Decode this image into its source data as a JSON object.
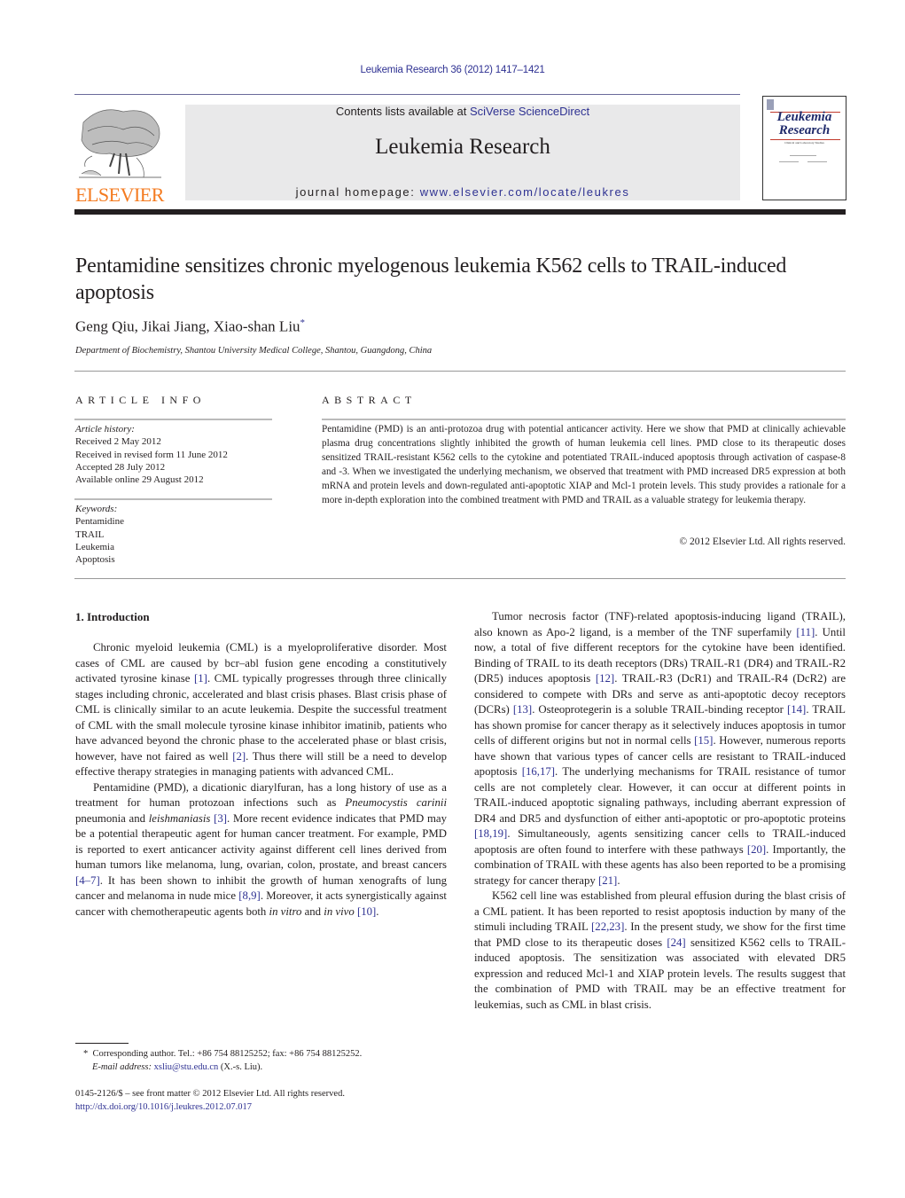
{
  "header": {
    "citation": "Leukemia Research 36 (2012) 1417–1421",
    "contents_prefix": "Contents lists available at ",
    "contents_link": "SciVerse ScienceDirect",
    "journal_name": "Leukemia Research",
    "homepage_prefix": "journal homepage: ",
    "homepage_link": "www.elsevier.com/locate/leukres",
    "publisher_logo_text": "ELSEVIER",
    "cover": {
      "title_line1": "Leukemia",
      "title_line2": "Research",
      "subtitle": "Clinical and Laboratory Studies"
    },
    "colors": {
      "link": "#2e3192",
      "elsevier_orange": "#f47b20",
      "masthead_bg": "#e9e9ea"
    }
  },
  "article": {
    "title": "Pentamidine sensitizes chronic myelogenous leukemia K562 cells to TRAIL-induced apoptosis",
    "authors": "Geng Qiu, Jikai Jiang, Xiao-shan Liu",
    "author_mark": "*",
    "affiliation": "Department of Biochemistry, Shantou University Medical College, Shantou, Guangdong, China"
  },
  "article_info": {
    "heading": "ARTICLE INFO",
    "history_label": "Article history:",
    "history": [
      "Received 2 May 2012",
      "Received in revised form 11 June 2012",
      "Accepted 28 July 2012",
      "Available online 29 August 2012"
    ],
    "keywords_label": "Keywords:",
    "keywords": [
      "Pentamidine",
      "TRAIL",
      "Leukemia",
      "Apoptosis"
    ]
  },
  "abstract": {
    "heading": "ABSTRACT",
    "text": "Pentamidine (PMD) is an anti-protozoa drug with potential anticancer activity. Here we show that PMD at clinically achievable plasma drug concentrations slightly inhibited the growth of human leukemia cell lines. PMD close to its therapeutic doses sensitized TRAIL-resistant K562 cells to the cytokine and potentiated TRAIL-induced apoptosis through activation of caspase-8 and -3. When we investigated the underlying mechanism, we observed that treatment with PMD increased DR5 expression at both mRNA and protein levels and down-regulated anti-apoptotic XIAP and Mcl-1 protein levels. This study provides a rationale for a more in-depth exploration into the combined treatment with PMD and TRAIL as a valuable strategy for leukemia therapy.",
    "copyright": "© 2012 Elsevier Ltd. All rights reserved."
  },
  "introduction": {
    "heading": "1.  Introduction",
    "left_paragraphs": [
      [
        {
          "t": "Chronic myeloid leukemia (CML) is a myeloproliferative disorder. Most cases of CML are caused by bcr–abl fusion gene encoding a constitutively activated tyrosine kinase "
        },
        {
          "t": "[1]",
          "ref": true
        },
        {
          "t": ". CML typically progresses through three clinically stages including chronic, accelerated and blast crisis phases. Blast crisis phase of CML is clinically similar to an acute leukemia. Despite the successful treatment of CML with the small molecule tyrosine kinase inhibitor imatinib, patients who have advanced beyond the chronic phase to the accelerated phase or blast crisis, however, have not faired as well "
        },
        {
          "t": "[2]",
          "ref": true
        },
        {
          "t": ". Thus there will still be a need to develop effective therapy strategies in managing patients with advanced CML."
        }
      ],
      [
        {
          "t": "Pentamidine (PMD), a dicationic diarylfuran, has a long history of use as a treatment for human protozoan infections such as "
        },
        {
          "t": "Pneumocystis carinii",
          "it": true
        },
        {
          "t": " pneumonia and "
        },
        {
          "t": "leishmaniasis",
          "it": true
        },
        {
          "t": " "
        },
        {
          "t": "[3]",
          "ref": true
        },
        {
          "t": ". More recent evidence indicates that PMD may be a potential therapeutic agent for human cancer treatment. For example, PMD is reported to exert anticancer activity against different cell lines derived from human tumors like melanoma, lung, ovarian, colon, prostate, and breast cancers "
        },
        {
          "t": "[4–7]",
          "ref": true
        },
        {
          "t": ". It has been shown to inhibit the growth of human xenografts of lung cancer and melanoma in nude mice "
        },
        {
          "t": "[8,9]",
          "ref": true
        },
        {
          "t": ". Moreover, it acts synergistically against cancer with chemotherapeutic agents both "
        },
        {
          "t": "in vitro",
          "it": true
        },
        {
          "t": " and "
        },
        {
          "t": "in vivo",
          "it": true
        },
        {
          "t": " "
        },
        {
          "t": "[10]",
          "ref": true
        },
        {
          "t": "."
        }
      ]
    ],
    "right_paragraphs": [
      [
        {
          "t": "Tumor necrosis factor (TNF)-related apoptosis-inducing ligand (TRAIL), also known as Apo-2 ligand, is a member of the TNF superfamily "
        },
        {
          "t": "[11]",
          "ref": true
        },
        {
          "t": ". Until now, a total of five different receptors for the cytokine have been identified. Binding of TRAIL to its death receptors (DRs) TRAIL-R1 (DR4) and TRAIL-R2 (DR5) induces apoptosis "
        },
        {
          "t": "[12]",
          "ref": true
        },
        {
          "t": ". TRAIL-R3 (DcR1) and TRAIL-R4 (DcR2) are considered to compete with DRs and serve as anti-apoptotic decoy receptors (DCRs) "
        },
        {
          "t": "[13]",
          "ref": true
        },
        {
          "t": ". Osteoprotegerin is a soluble TRAIL-binding receptor "
        },
        {
          "t": "[14]",
          "ref": true
        },
        {
          "t": ". TRAIL has shown promise for cancer therapy as it selectively induces apoptosis in tumor cells of different origins but not in normal cells "
        },
        {
          "t": "[15]",
          "ref": true
        },
        {
          "t": ". However, numerous reports have shown that various types of cancer cells are resistant to TRAIL-induced apoptosis "
        },
        {
          "t": "[16,17]",
          "ref": true
        },
        {
          "t": ". The underlying mechanisms for TRAIL resistance of tumor cells are not completely clear. However, it can occur at different points in TRAIL-induced apoptotic signaling pathways, including aberrant expression of DR4 and DR5 and dysfunction of either anti-apoptotic or pro-apoptotic proteins "
        },
        {
          "t": "[18,19]",
          "ref": true
        },
        {
          "t": ". Simultaneously, agents sensitizing cancer cells to TRAIL-induced apoptosis are often found to interfere with these pathways "
        },
        {
          "t": "[20]",
          "ref": true
        },
        {
          "t": ". Importantly, the combination of TRAIL with these agents has also been reported to be a promising strategy for cancer therapy "
        },
        {
          "t": "[21]",
          "ref": true
        },
        {
          "t": "."
        }
      ],
      [
        {
          "t": "K562 cell line was established from pleural effusion during the blast crisis of a CML patient. It has been reported to resist apoptosis induction by many of the stimuli including TRAIL "
        },
        {
          "t": "[22,23]",
          "ref": true
        },
        {
          "t": ". In the present study, we show for the first time that PMD close to its therapeutic doses "
        },
        {
          "t": "[24]",
          "ref": true
        },
        {
          "t": " sensitized K562 cells to TRAIL-induced apoptosis. The sensitization was associated with elevated DR5 expression and reduced Mcl-1 and XIAP protein levels. The results suggest that the combination of PMD with TRAIL may be an effective treatment for leukemias, such as CML in blast crisis."
        }
      ]
    ]
  },
  "footnote": {
    "mark": "*",
    "text": "Corresponding author. Tel.: +86 754 88125252; fax: +86 754 88125252.",
    "email_label": "E-mail address:",
    "email": "xsliu@stu.edu.cn",
    "email_suffix": " (X.-s. Liu)."
  },
  "issn": {
    "line": "0145-2126/$ – see front matter © 2012 Elsevier Ltd. All rights reserved.",
    "doi": "http://dx.doi.org/10.1016/j.leukres.2012.07.017"
  }
}
